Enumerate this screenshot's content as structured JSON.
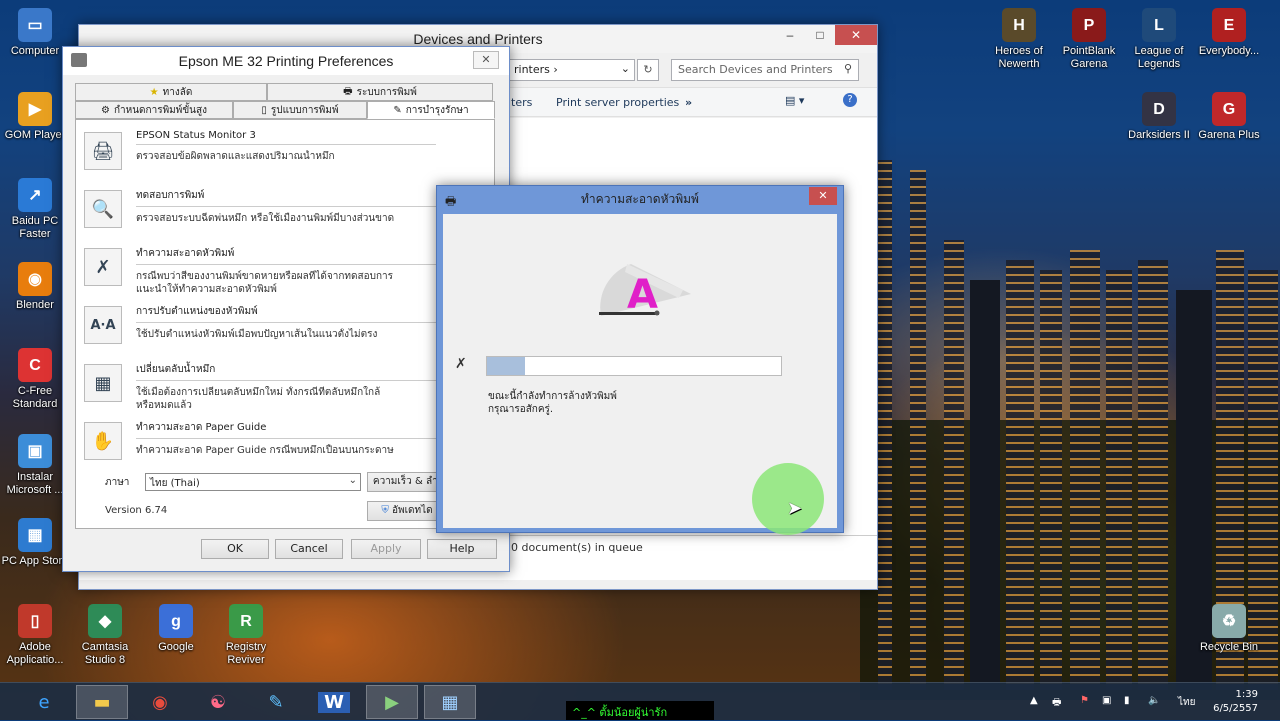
{
  "desktop_left": [
    {
      "label": "Computer",
      "icon": "computer-icon",
      "color": "#3a78c9"
    },
    {
      "label": "GOM Player",
      "icon": "gom-player-icon",
      "color": "#e8a020"
    },
    {
      "label": "Baidu PC Faster",
      "icon": "baidu-pc-faster-icon",
      "color": "#2a7ad6"
    },
    {
      "label": "Blender",
      "icon": "blender-icon",
      "color": "#e87d0d"
    },
    {
      "label": "C-Free Standard",
      "icon": "c-free-icon",
      "color": "#d33"
    },
    {
      "label": "Instalar Microsoft ...",
      "icon": "installer-icon",
      "color": "#3c8dd8"
    },
    {
      "label": "PC App Store",
      "icon": "pc-app-store-icon",
      "color": "#2d7bd0"
    },
    {
      "label": "Adobe Applicatio...",
      "icon": "adobe-icon",
      "color": "#c0392b"
    },
    {
      "label": "Camtasia Studio 8",
      "icon": "camtasia-icon",
      "color": "#2e8b57"
    },
    {
      "label": "Google",
      "icon": "google-icon",
      "color": "#3b6fd8"
    },
    {
      "label": "Registry Reviver",
      "icon": "registry-reviver-icon",
      "color": "#3a9a48"
    }
  ],
  "desktop_right": [
    {
      "label": "Heroes of Newerth",
      "icon": "heroes-of-newerth-icon",
      "color": "#5a4a2a"
    },
    {
      "label": "PointBlank Garena",
      "icon": "pointblank-icon",
      "color": "#8a1a1a"
    },
    {
      "label": "League of Legends",
      "icon": "league-of-legends-icon",
      "color": "#1f4a7a"
    },
    {
      "label": "Everybody...",
      "icon": "everybody-icon",
      "color": "#b02020"
    },
    {
      "label": "Darksiders II",
      "icon": "darksiders-icon",
      "color": "#334"
    },
    {
      "label": "Garena Plus",
      "icon": "garena-plus-icon",
      "color": "#c0282a"
    },
    {
      "label": "Recycle Bin",
      "icon": "recycle-bin-icon",
      "color": "#8aa"
    }
  ],
  "devices_window": {
    "title": "Devices and Printers",
    "address": "rinters",
    "search_placeholder": "Search Devices and Printers",
    "cmd_printers": "ters",
    "cmd_print_server": "Print server properties",
    "cmd_more": "»",
    "status": "0 document(s) in queue"
  },
  "epson_window": {
    "title": "Epson ME 32 Printing Preferences",
    "tabs_back": [
      "ทางลัด",
      "ระบบการพิมพ์"
    ],
    "tabs_front": [
      "กำหนดการพิมพ์ขั้นสูง",
      "รูปแบบการพิมพ์",
      "การบำรุงรักษา"
    ],
    "items": [
      {
        "title": "EPSON Status Monitor 3",
        "desc": "ตรวจสอบข้อผิดพลาดและแสดงปริมาณน้ำหมึก",
        "icon": "status-monitor-icon"
      },
      {
        "title": "ทดสอบการพิมพ์",
        "desc": "ตรวจสอบระบบฉีดพ่นหมึก หรือใช้เมื่องานพิมพ์มีบางส่วนขาด",
        "icon": "nozzle-check-icon"
      },
      {
        "title": "ทำความสะอาดหัวพิมพ์",
        "desc": "กรณีพบว่าสีของงานพิมพ์ขาดหายหรือผลที่ได้จากทดสอบการ",
        "desc2": "แนะนำให้ทำความสะอาดหัวพิมพ์",
        "icon": "head-cleaning-icon"
      },
      {
        "title": "การปรับตำแหน่งของหัวพิมพ์",
        "desc": "ใช้ปรับตำแหน่งหัวพิมพ์เมื่อพบปัญหาเส้นในแนวตั้งไม่ตรง",
        "icon": "print-head-alignment-icon"
      },
      {
        "title": "เปลี่ยนตลับน้ำหมึก",
        "desc": "ใช้เมื่อต้องการเปลี่ยนตลับหมึกใหม่ ทั้งกรณีที่ตลับหมึกใกล้",
        "desc2": "หรือหมดแล้ว",
        "icon": "ink-cartridge-icon"
      },
      {
        "title": "ทำความสะอาด Paper Guide",
        "desc": "ทำความสะอาด Paper Guide กรณีพบหมึกเปื้อนบนกระดาษ",
        "icon": "paper-guide-icon"
      }
    ],
    "language_label": "ภาษา",
    "language_value": "ไทย (Thai)",
    "speed_button": "ความเร็ว & ลำเ",
    "version": "Version 6.74",
    "update_button": "อัพเดทได",
    "buttons": {
      "ok": "OK",
      "cancel": "Cancel",
      "apply": "Apply",
      "help": "Help"
    }
  },
  "head_cleaning": {
    "title": "ทำความสะอาดหัวพิมพ์",
    "progress": 0.13,
    "message_line1": "ขณะนี้กำลังทำการล้างหัวพิมพ์",
    "message_line2": "กรุณารอสักครู่."
  },
  "taskbar": {
    "apps": [
      "internet-explorer-icon",
      "file-explorer-icon",
      "chrome-icon",
      "app-swirl-icon",
      "paint-icon",
      "word-icon",
      "media-app-icon",
      "control-panel-icon"
    ],
    "marquee": "^_^ ตั้มน้อยผู้น่ารัก",
    "lang": "ไทย",
    "time": "1:39",
    "date": "6/5/2557"
  }
}
